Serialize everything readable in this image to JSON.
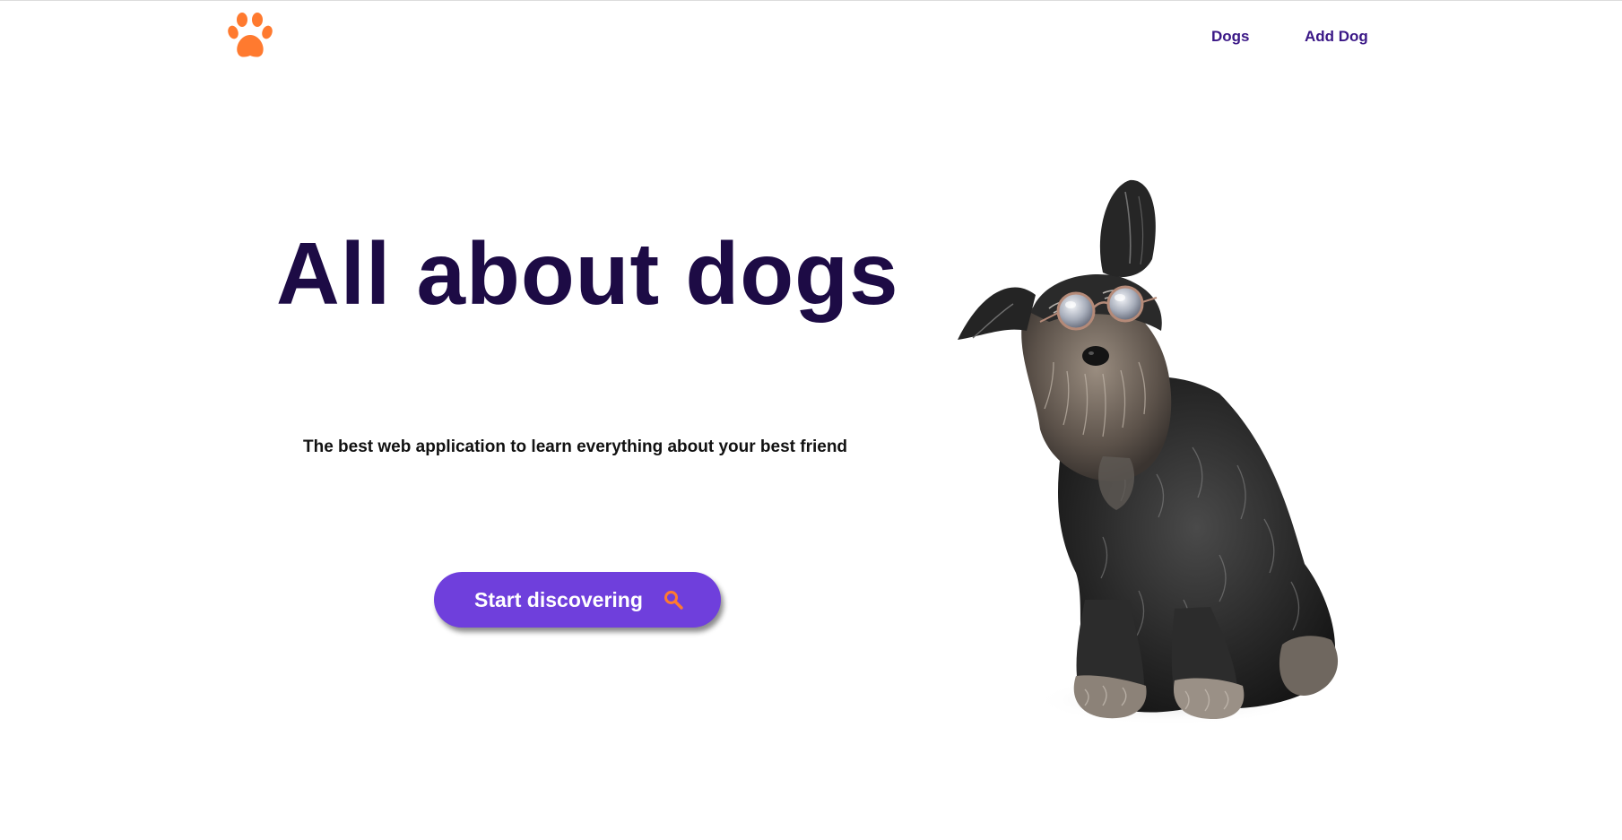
{
  "header": {
    "logo_icon": "paw-icon",
    "logo_color": "#ff7a2f",
    "nav": [
      {
        "label": "Dogs"
      },
      {
        "label": "Add Dog"
      }
    ],
    "nav_color": "#3a1786"
  },
  "hero": {
    "title": "All about dogs",
    "subtitle": "The best web application to learn everything about your best friend",
    "cta_label": "Start discovering",
    "cta_icon": "search-icon",
    "cta_color": "#6f3fdc",
    "cta_icon_color": "#ff7a2f",
    "title_color": "#1d0b45",
    "image": "dog-photo"
  }
}
